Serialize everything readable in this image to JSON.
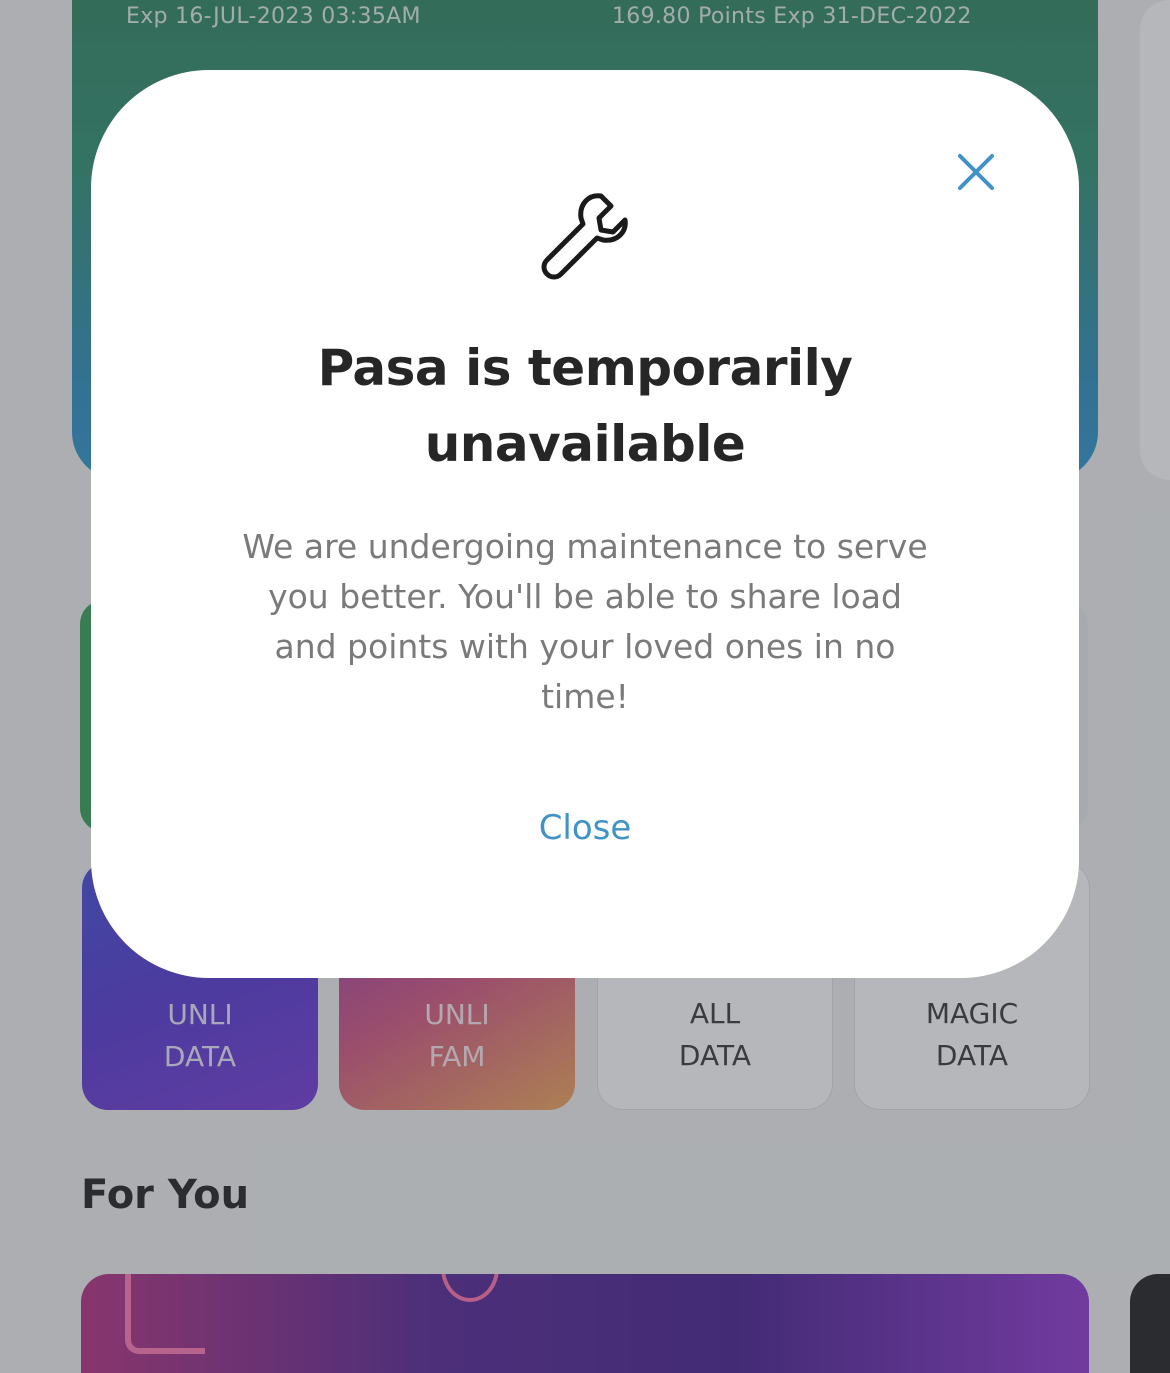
{
  "header": {
    "expiry_left": "Exp 16-JUL-2023 03:35AM",
    "expiry_right": "169.80 Points Exp 31-DEC-2022"
  },
  "tiles": [
    {
      "line1": "UNLI",
      "line2": "DATA"
    },
    {
      "line1": "UNLI",
      "line2": "FAM"
    },
    {
      "line1": "ALL",
      "line2": "DATA"
    },
    {
      "line1": "MAGIC",
      "line2": "DATA"
    }
  ],
  "section": {
    "for_you_title": "For You"
  },
  "modal": {
    "icon": "wrench-icon",
    "title": "Pasa is temporarily unavailable",
    "body": "We are undergoing maintenance to serve you better. You'll be able to share load and points with your loved ones in no time!",
    "close_label": "Close",
    "close_icon": "close-icon"
  },
  "colors": {
    "accent": "#3f93c6",
    "title": "#262626",
    "body": "#7a7a7a"
  }
}
